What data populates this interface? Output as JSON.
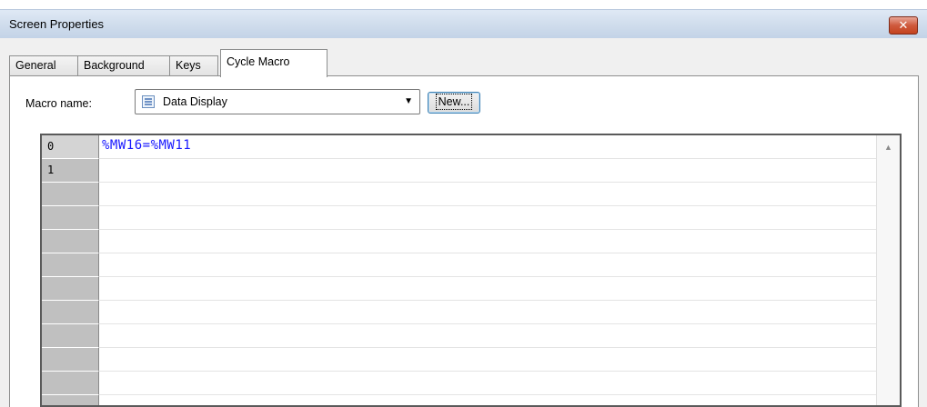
{
  "window": {
    "title": "Screen Properties",
    "close_glyph": "✕"
  },
  "tabs": [
    {
      "label": "General",
      "active": false
    },
    {
      "label": "Background",
      "active": false
    },
    {
      "label": "Keys",
      "active": false
    },
    {
      "label": "Cycle Macro",
      "active": true
    }
  ],
  "macro": {
    "label": "Macro name:",
    "selected": "Data Display",
    "icon": "list-lines-icon",
    "new_button": "New..."
  },
  "editor": {
    "rows": [
      {
        "num": "0",
        "code": "%MW16=%MW11"
      },
      {
        "num": "1",
        "code": ""
      },
      {
        "num": "",
        "code": ""
      },
      {
        "num": "",
        "code": ""
      },
      {
        "num": "",
        "code": ""
      },
      {
        "num": "",
        "code": ""
      },
      {
        "num": "",
        "code": ""
      },
      {
        "num": "",
        "code": ""
      },
      {
        "num": "",
        "code": ""
      },
      {
        "num": "",
        "code": ""
      },
      {
        "num": "",
        "code": ""
      },
      {
        "num": "",
        "code": ""
      }
    ],
    "code_color": "#1a1aff"
  }
}
